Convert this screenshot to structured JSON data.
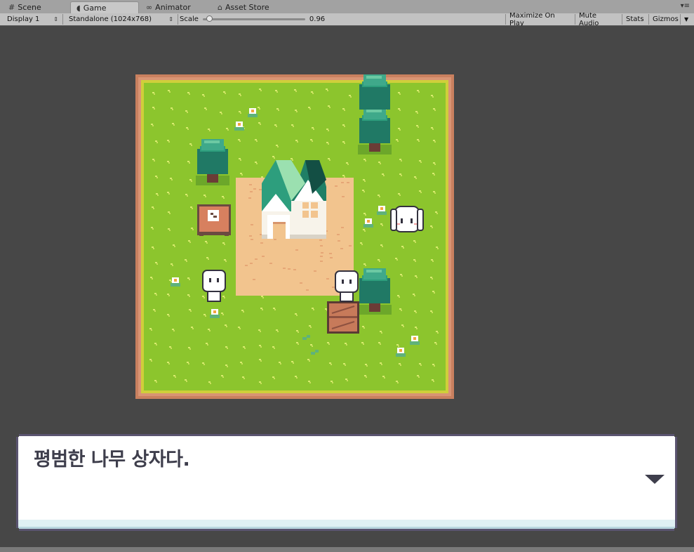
{
  "tabs": [
    {
      "label": "Scene",
      "icon": "grid-icon",
      "active": false
    },
    {
      "label": "Game",
      "icon": "pacman-icon",
      "active": true
    },
    {
      "label": "Animator",
      "icon": "animator-icon",
      "active": false
    },
    {
      "label": "Asset Store",
      "icon": "store-icon",
      "active": false
    }
  ],
  "toolbar": {
    "display": "Display 1",
    "resolution": "Standalone (1024x768)",
    "scale_label": "Scale",
    "scale_value": "0.96",
    "scale_level": 0.04,
    "maximize": "Maximize On Play",
    "mute": "Mute Audio",
    "stats": "Stats",
    "gizmos": "Gizmos"
  },
  "dialog": {
    "text": "평범한 나무 상자다."
  },
  "colors": {
    "grass": "#8cc52d",
    "grass_light": "#d2e86a",
    "border": "#c9805f",
    "dirt": "#f2c48e",
    "tree_light": "#3fa98a",
    "tree_dark": "#207965",
    "roof": "#1e7f66",
    "crate": "#c77a5a",
    "dialog_bg": "#ffffff",
    "dialog_border": "#5a5470",
    "dialog_text": "#3e3e4c"
  }
}
